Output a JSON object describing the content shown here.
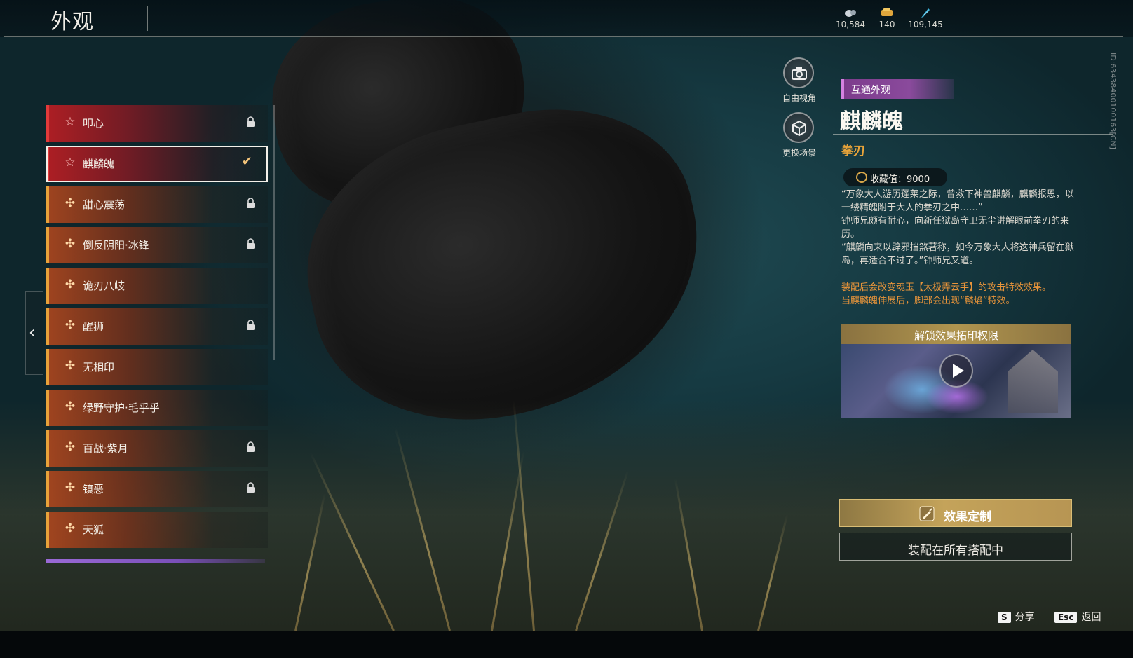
{
  "header": {
    "title": "外观",
    "currencies": [
      {
        "icon": "coin-pouch-icon",
        "value": "10,584"
      },
      {
        "icon": "ticket-icon",
        "value": "140"
      },
      {
        "icon": "feather-icon",
        "value": "109,145"
      }
    ]
  },
  "list": {
    "items": [
      {
        "label": "叩心",
        "icon": "star-icon",
        "rarity": "red",
        "locked": true,
        "selected": false
      },
      {
        "label": "麒麟魄",
        "icon": "star-icon",
        "rarity": "red",
        "locked": false,
        "selected": true
      },
      {
        "label": "甜心震荡",
        "icon": "petal-icon",
        "rarity": "orange",
        "locked": true,
        "selected": false
      },
      {
        "label": "倒反阴阳·冰锋",
        "icon": "petal-icon",
        "rarity": "orange",
        "locked": true,
        "selected": false
      },
      {
        "label": "诡刃八岐",
        "icon": "petal-icon",
        "rarity": "orange",
        "locked": false,
        "selected": false
      },
      {
        "label": "醒狮",
        "icon": "petal-icon",
        "rarity": "orange",
        "locked": true,
        "selected": false
      },
      {
        "label": "无相印",
        "icon": "petal-icon",
        "rarity": "orange",
        "locked": false,
        "selected": false
      },
      {
        "label": "绿野守护·毛乎乎",
        "icon": "petal-icon",
        "rarity": "orange",
        "locked": false,
        "selected": false
      },
      {
        "label": "百战·紫月",
        "icon": "petal-icon",
        "rarity": "orange",
        "locked": true,
        "selected": false
      },
      {
        "label": "镇恶",
        "icon": "petal-icon",
        "rarity": "orange",
        "locked": true,
        "selected": false
      },
      {
        "label": "天狐",
        "icon": "petal-icon",
        "rarity": "orange",
        "locked": false,
        "selected": false
      }
    ]
  },
  "camera": {
    "free_view_label": "自由视角",
    "change_scene_label": "更换场景"
  },
  "detail": {
    "tag": "互通外观",
    "name": "麒麟魄",
    "type": "拳刃",
    "collect_value": "收藏值：9000",
    "description": [
      "“万象大人游历蓬莱之际，曾救下神兽麒麟，麒麟报恩，以一缕精魄附于大人的拳刃之中……”",
      "钟师兄颇有耐心，向新任狱岛守卫无尘讲解眼前拳刃的来历。",
      "“麒麟向来以辟邪挡煞著称，如今万象大人将这神兵留在狱岛，再适合不过了。”钟师兄又道。"
    ],
    "effect": [
      "装配后会改变魂玉【太极弄云手】的攻击特效效果。",
      "当麒麟魄伸展后，脚部会出现“麟焰”特效。"
    ],
    "unlock_label": "解锁效果拓印权限",
    "custom_button": "效果定制",
    "equip_button": "装配在所有搭配中"
  },
  "side_id": "ID:63438400100163[CN]",
  "hotkeys": [
    {
      "key": "S",
      "label": "分享"
    },
    {
      "key": "Esc",
      "label": "返回"
    }
  ],
  "colors": {
    "accent_gold": "#e9a43a",
    "tag_purple": "#8a4a9c",
    "red_rarity": "#e23a3a",
    "orange_rarity": "#e8a23a"
  }
}
